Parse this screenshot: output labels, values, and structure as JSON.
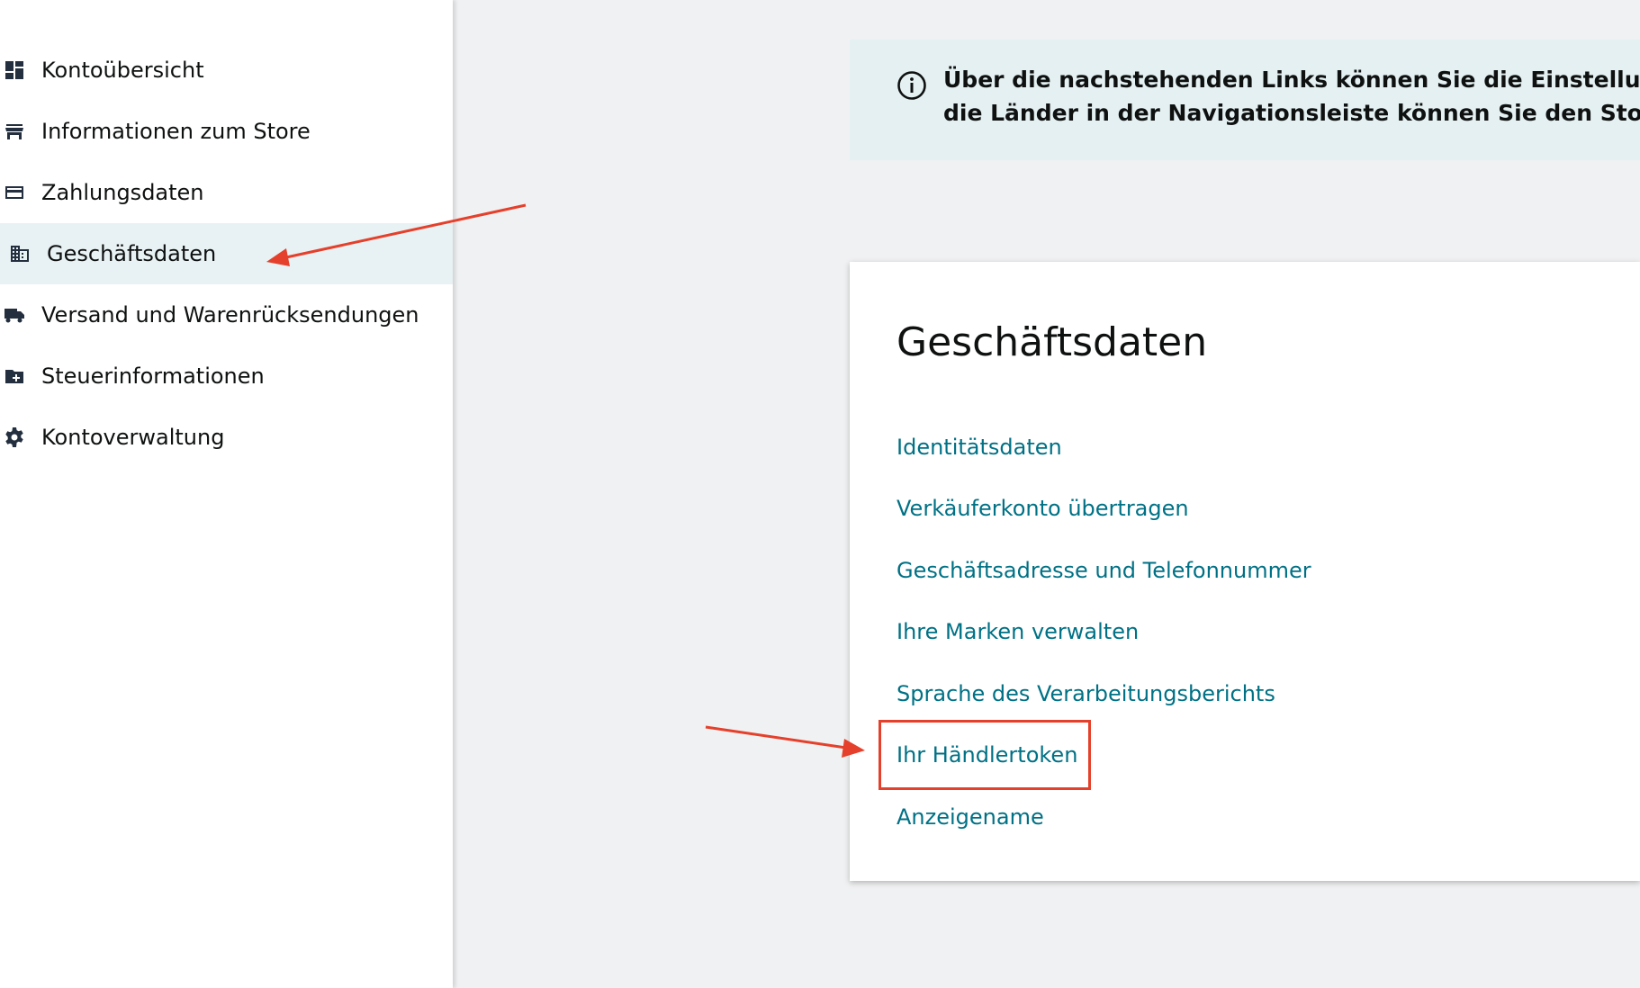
{
  "sidebar": {
    "items": [
      {
        "label": "Kontoübersicht",
        "icon": "dashboard-icon"
      },
      {
        "label": "Informationen zum Store",
        "icon": "store-icon"
      },
      {
        "label": "Zahlungsdaten",
        "icon": "credit-card-icon"
      },
      {
        "label": "Geschäftsdaten",
        "icon": "building-icon",
        "active": true
      },
      {
        "label": "Versand und Warenrücksendungen",
        "icon": "truck-icon"
      },
      {
        "label": "Steuerinformationen",
        "icon": "folder-plus-icon"
      },
      {
        "label": "Kontoverwaltung",
        "icon": "gear-icon"
      }
    ]
  },
  "banner": {
    "icon": "info-icon",
    "line1": "Über die nachstehenden Links können Sie die Einstellunger",
    "line2": "die Länder in der Navigationsleiste können Sie den Store är"
  },
  "card": {
    "title": "Geschäftsdaten",
    "links": [
      "Identitätsdaten",
      "Verkäuferkonto übertragen",
      "Geschäftsadresse und Telefonnummer",
      "Ihre Marken verwalten",
      "Sprache des Verarbeitungsberichts",
      "Ihr Händlertoken",
      "Anzeigename"
    ]
  },
  "colors": {
    "link": "#007185",
    "annotation": "#e5402b",
    "active_bg": "#e8f1f3",
    "banner_bg": "#e4f0f1"
  }
}
